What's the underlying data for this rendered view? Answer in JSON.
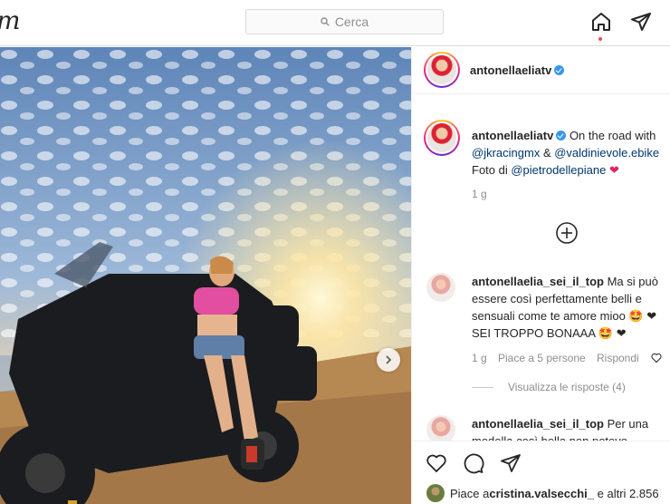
{
  "topbar": {
    "logo_partial": "m",
    "search_placeholder": "Cerca",
    "home_icon": "home-icon",
    "direct_icon": "paper-plane-icon"
  },
  "post": {
    "author": "antonellaeliatv",
    "verified": true,
    "caption": {
      "text_1": "On the road with",
      "mention_1": "@jkracingmx",
      "amp": " & ",
      "mention_2": "@valdinievole.ebike",
      "text_2": "Foto di ",
      "mention_3": "@pietrodellepiane",
      "heart": "❤",
      "time": "1 g"
    },
    "comments": [
      {
        "user": "antonellaelia_sei_il_top",
        "text": "Ma si può essere così perfettamente belli e sensuali come te amore mioo 🤩 ❤ SEI TROPPO BONAAA 🤩 ❤",
        "time": "1 g",
        "likes": "Piace a 5 persone",
        "reply": "Rispondi",
        "view_replies": "Visualizza le risposte (4)"
      },
      {
        "user": "antonellaelia_sei_il_top",
        "text": "Per una modella così bella non potevo"
      }
    ],
    "likes_text_prefix": "Piace a ",
    "likes_user": "cristina.valsecchi_",
    "likes_text_suffix": " e altri 2.856"
  },
  "colors": {
    "accent_link": "#00376b",
    "verified_blue": "#3897f0",
    "heart_red": "#e0245e",
    "notification_dot": "#ed4956"
  }
}
